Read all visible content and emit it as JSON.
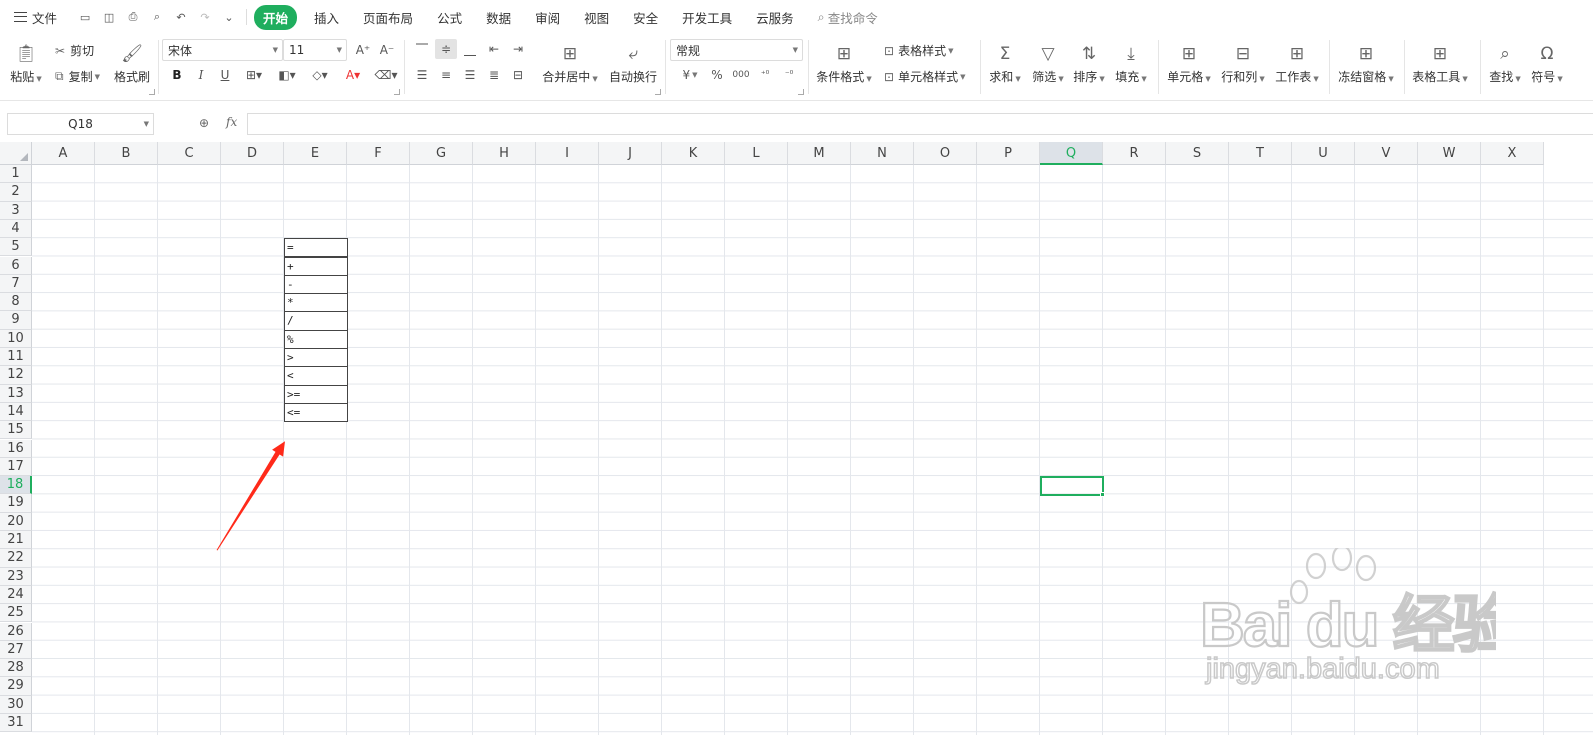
{
  "menubar": {
    "file_label": "文件",
    "quick_icons": [
      "save-icon",
      "save-as-icon",
      "print-icon",
      "print-preview-icon",
      "undo-icon",
      "redo-icon",
      "customize-icon"
    ],
    "tabs": [
      "开始",
      "插入",
      "页面布局",
      "公式",
      "数据",
      "审阅",
      "视图",
      "安全",
      "开发工具",
      "云服务"
    ],
    "active_tab": "开始",
    "search_label": "查找命令"
  },
  "ribbon": {
    "paste": "粘贴",
    "cut": "剪切",
    "copy": "复制",
    "format_painter": "格式刷",
    "font_name": "宋体",
    "font_size": "11",
    "bold": "B",
    "italic": "I",
    "underline": "U",
    "merge_center": "合并居中",
    "wrap_text": "自动换行",
    "number_format": "常规",
    "currency": "¥",
    "percent": "%",
    "thousands": "000",
    "conditional_format": "条件格式",
    "table_style": "表格样式",
    "cell_style": "单元格样式",
    "sum": "求和",
    "filter": "筛选",
    "sort": "排序",
    "fill": "填充",
    "cell": "单元格",
    "row_col": "行和列",
    "worksheet": "工作表",
    "freeze": "冻结窗格",
    "table_tools": "表格工具",
    "find": "查找",
    "symbol": "符号"
  },
  "formula_bar": {
    "name_box": "Q18",
    "fx": "fx",
    "formula": ""
  },
  "sheet": {
    "columns": [
      "A",
      "B",
      "C",
      "D",
      "E",
      "F",
      "G",
      "H",
      "I",
      "J",
      "K",
      "L",
      "M",
      "N",
      "O",
      "P",
      "Q",
      "R",
      "S",
      "T",
      "U",
      "V",
      "W",
      "X"
    ],
    "rows": [
      "1",
      "2",
      "3",
      "4",
      "5",
      "6",
      "7",
      "8",
      "9",
      "10",
      "11",
      "12",
      "13",
      "14",
      "15",
      "16",
      "17",
      "18",
      "19",
      "20",
      "21",
      "22",
      "23",
      "24",
      "25",
      "26",
      "27",
      "28",
      "29",
      "30",
      "31"
    ],
    "selected_column": "Q",
    "selected_row": "18",
    "operator_cells": [
      {
        "ref": "E5",
        "value": "="
      },
      {
        "ref": "E6",
        "value": "+"
      },
      {
        "ref": "E7",
        "value": "-"
      },
      {
        "ref": "E8",
        "value": "*"
      },
      {
        "ref": "E9",
        "value": "/"
      },
      {
        "ref": "E10",
        "value": "%"
      },
      {
        "ref": "E11",
        "value": ">"
      },
      {
        "ref": "E12",
        "value": "<"
      },
      {
        "ref": "E13",
        "value": ">="
      },
      {
        "ref": "E14",
        "value": "<="
      }
    ]
  },
  "annotation": {
    "arrow_color": "#ff2a1a"
  },
  "watermark": {
    "brand_text": "Bai du 经验",
    "url_text": "jingyan.baidu.com"
  },
  "colors": {
    "accent": "#1fae5e"
  }
}
